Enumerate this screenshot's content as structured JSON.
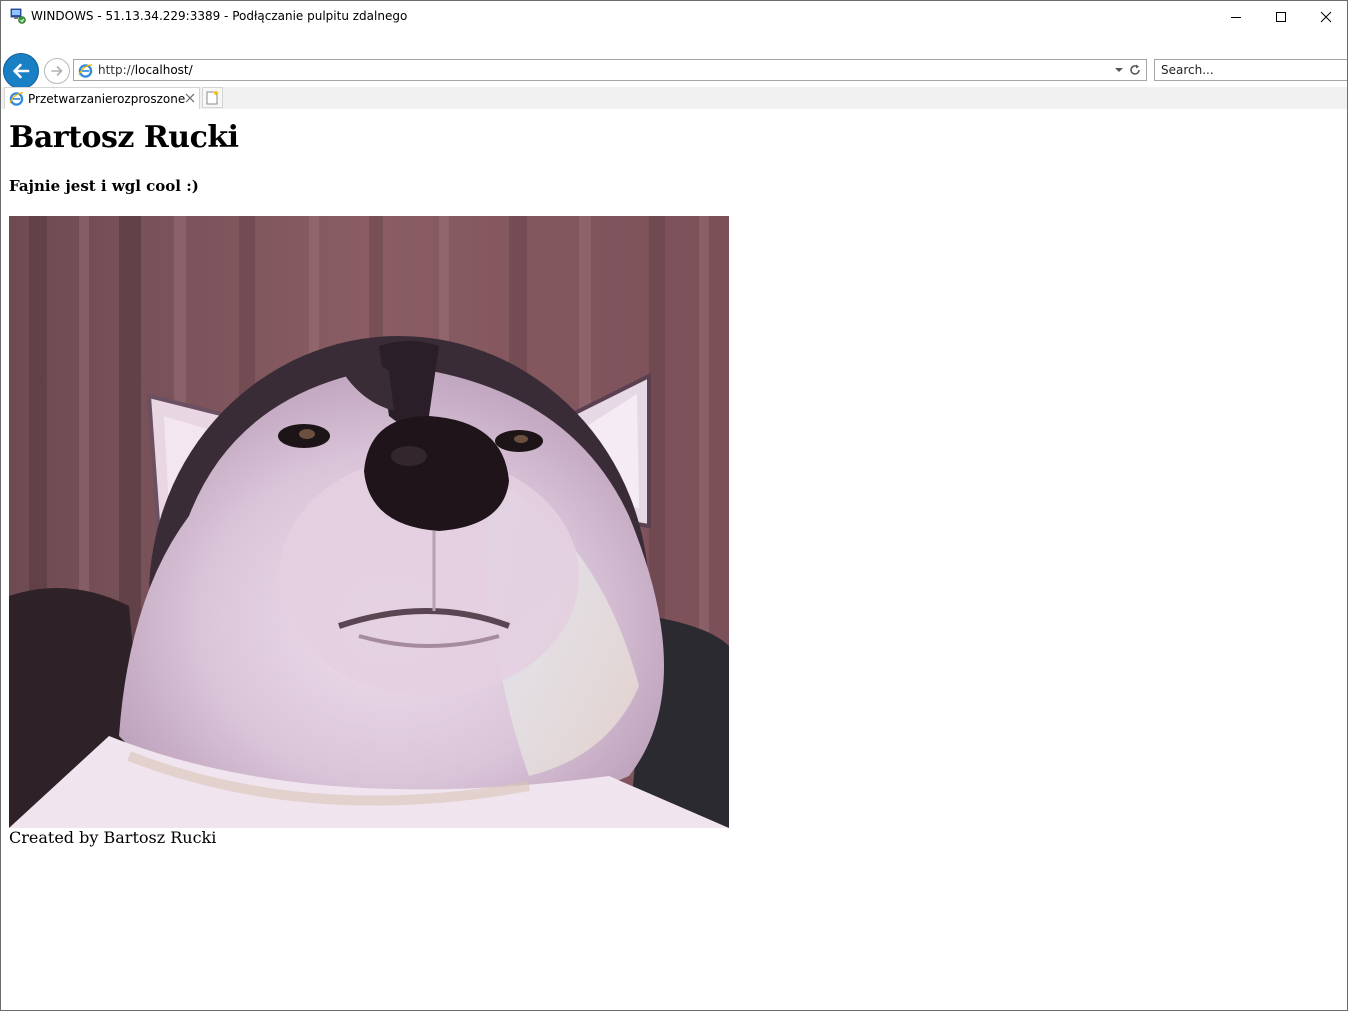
{
  "window": {
    "title": "WINDOWS - 51.13.34.229:3389 - Podłączanie pulpitu zdalnego"
  },
  "browser": {
    "address": {
      "scheme": "http://",
      "host": "localhost/"
    },
    "search": {
      "placeholder": "Search..."
    },
    "tabs": [
      {
        "label": "Przetwarzanierozproszone",
        "active": true
      }
    ],
    "accent_color": "#1a80c6"
  },
  "page": {
    "heading": "Bartosz Rucki",
    "subheading": "Fajnie jest i wgl cool :)",
    "footer": "Created by Bartosz Rucki"
  },
  "icons": {
    "app": "remote-desktop-icon",
    "back": "back-arrow-icon",
    "forward": "forward-arrow-icon",
    "site": "internet-explorer-icon",
    "dropdown": "chevron-down-icon",
    "refresh": "refresh-icon",
    "close_tab": "close-icon",
    "new_tab": "new-tab-icon",
    "minimize": "minimize-icon",
    "maximize": "maximize-icon",
    "close": "close-icon"
  }
}
